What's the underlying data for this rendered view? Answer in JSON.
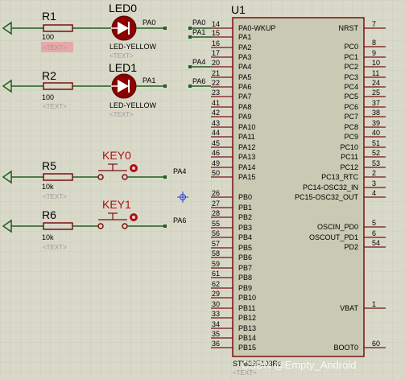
{
  "components": {
    "r1": {
      "ref": "R1",
      "value": "100",
      "text": "<TEXT>"
    },
    "r2": {
      "ref": "R2",
      "value": "100",
      "text": "<TEXT>"
    },
    "r5": {
      "ref": "R5",
      "value": "10k",
      "text": "<TEXT>"
    },
    "r6": {
      "ref": "R6",
      "value": "10k",
      "text": "<TEXT>"
    },
    "led0": {
      "ref": "LED0",
      "value": "LED-YELLOW",
      "text": "<TEXT>"
    },
    "led1": {
      "ref": "LED1",
      "value": "LED-YELLOW",
      "text": "<TEXT>"
    },
    "key0": {
      "ref": "KEY0"
    },
    "key1": {
      "ref": "KEY1"
    }
  },
  "net_labels": {
    "pa0_left": "PA0",
    "pa1_left": "PA1",
    "pa4_key": "PA4",
    "pa6_key": "PA6",
    "pa0_right": "PA0",
    "pa1_right": "PA1",
    "pa4_right": "PA4",
    "pa6_right": "PA6"
  },
  "chip": {
    "ref": "U1",
    "part": "STM32F103R6",
    "text": "<TEXT>",
    "left_pins": [
      {
        "num": "14",
        "name": "PA0-WKUP"
      },
      {
        "num": "15",
        "name": "PA1"
      },
      {
        "num": "16",
        "name": "PA2"
      },
      {
        "num": "17",
        "name": "PA3"
      },
      {
        "num": "20",
        "name": "PA4"
      },
      {
        "num": "21",
        "name": "PA5"
      },
      {
        "num": "22",
        "name": "PA6"
      },
      {
        "num": "23",
        "name": "PA7"
      },
      {
        "num": "41",
        "name": "PA8"
      },
      {
        "num": "42",
        "name": "PA9"
      },
      {
        "num": "43",
        "name": "PA10"
      },
      {
        "num": "44",
        "name": "PA11"
      },
      {
        "num": "45",
        "name": "PA12"
      },
      {
        "num": "46",
        "name": "PA13"
      },
      {
        "num": "49",
        "name": "PA14"
      },
      {
        "num": "50",
        "name": "PA15"
      },
      {
        "num": "26",
        "name": "PB0"
      },
      {
        "num": "27",
        "name": "PB1"
      },
      {
        "num": "28",
        "name": "PB2"
      },
      {
        "num": "55",
        "name": "PB3"
      },
      {
        "num": "56",
        "name": "PB4"
      },
      {
        "num": "57",
        "name": "PB5"
      },
      {
        "num": "58",
        "name": "PB6"
      },
      {
        "num": "59",
        "name": "PB7"
      },
      {
        "num": "61",
        "name": "PB8"
      },
      {
        "num": "62",
        "name": "PB9"
      },
      {
        "num": "29",
        "name": "PB10"
      },
      {
        "num": "30",
        "name": "PB11"
      },
      {
        "num": "33",
        "name": "PB12"
      },
      {
        "num": "34",
        "name": "PB13"
      },
      {
        "num": "35",
        "name": "PB14"
      },
      {
        "num": "36",
        "name": "PB15"
      }
    ],
    "right_pins": [
      {
        "num": "7",
        "name": "NRST"
      },
      {
        "num": "8",
        "name": "PC0"
      },
      {
        "num": "9",
        "name": "PC1"
      },
      {
        "num": "10",
        "name": "PC2"
      },
      {
        "num": "11",
        "name": "PC3"
      },
      {
        "num": "24",
        "name": "PC4"
      },
      {
        "num": "25",
        "name": "PC5"
      },
      {
        "num": "37",
        "name": "PC6"
      },
      {
        "num": "38",
        "name": "PC7"
      },
      {
        "num": "39",
        "name": "PC8"
      },
      {
        "num": "40",
        "name": "PC9"
      },
      {
        "num": "51",
        "name": "PC10"
      },
      {
        "num": "52",
        "name": "PC11"
      },
      {
        "num": "53",
        "name": "PC12"
      },
      {
        "num": "2",
        "name": "PC13_RTC"
      },
      {
        "num": "3",
        "name": "PC14-OSC32_IN"
      },
      {
        "num": "4",
        "name": "PC15-OSC32_OUT"
      },
      {
        "num": "5",
        "name": "OSCIN_PD0"
      },
      {
        "num": "6",
        "name": "OSCOUT_PD1"
      },
      {
        "num": "54",
        "name": "PD2"
      },
      {
        "num": "1",
        "name": "VBAT"
      },
      {
        "num": "60",
        "name": "BOOT0"
      }
    ]
  },
  "watermark": "CSDN @Empty_Android"
}
